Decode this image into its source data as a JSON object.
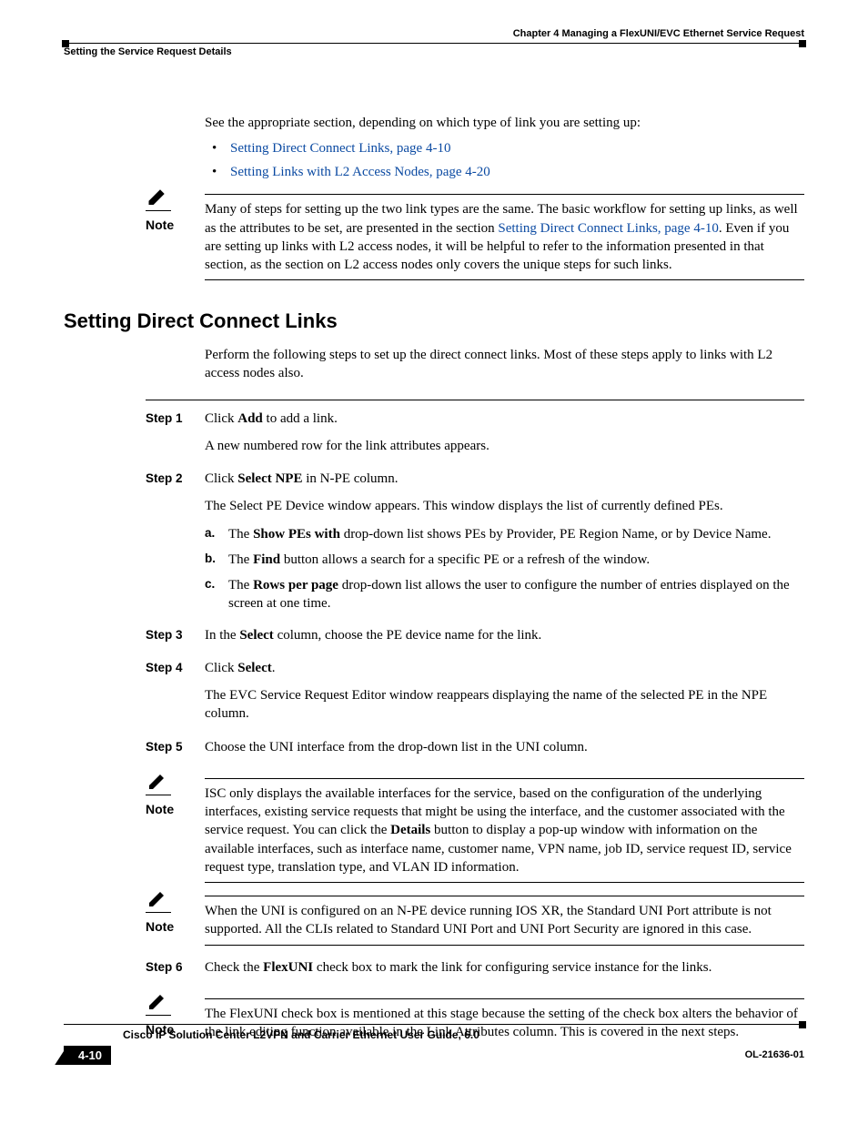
{
  "header": {
    "chapter": "Chapter 4      Managing a FlexUNI/EVC Ethernet Service Request",
    "section": "Setting the Service Request Details"
  },
  "intro": {
    "lead": "See the appropriate section, depending on which type of link you are setting up:",
    "bullets": [
      "Setting Direct Connect Links, page 4-10",
      "Setting Links with L2 Access Nodes, page 4-20"
    ]
  },
  "note1": {
    "label": "Note",
    "text_a": "Many of steps for setting up the two link types are the same. The basic workflow for setting up links, as well as the attributes to be set, are presented in the section ",
    "link": "Setting Direct Connect Links, page 4-10",
    "text_b": ". Even if you are setting up links with L2 access nodes, it will be helpful to refer to the information presented in that section, as the section on L2 access nodes only covers the unique steps for such links."
  },
  "section_title": "Setting Direct Connect Links",
  "section_intro": "Perform the following steps to set up the direct connect links. Most of these steps apply to links with L2 access nodes also.",
  "steps": {
    "s1": {
      "label": "Step 1",
      "p1a": "Click ",
      "p1b": "Add",
      "p1c": " to add a link.",
      "p2": "A new numbered row for the link attributes appears."
    },
    "s2": {
      "label": "Step 2",
      "p1a": "Click ",
      "p1b": "Select NPE",
      "p1c": " in N-PE column.",
      "p2": "The Select PE Device window appears. This window displays the list of currently defined PEs.",
      "a": {
        "letter": "a.",
        "pre": "The ",
        "bold": "Show PEs with",
        "post": " drop-down list shows PEs by Provider, PE Region Name, or by Device Name."
      },
      "b": {
        "letter": "b.",
        "pre": "The ",
        "bold": "Find",
        "post": " button allows a search for a specific PE or a refresh of the window."
      },
      "c": {
        "letter": "c.",
        "pre": "The ",
        "bold": "Rows per page",
        "post": " drop-down list allows the user to configure the number of entries displayed on the screen at one time."
      }
    },
    "s3": {
      "label": "Step 3",
      "pre": "In the ",
      "bold": "Select",
      "post": " column, choose the PE device name for the link."
    },
    "s4": {
      "label": "Step 4",
      "pre": "Click ",
      "bold": "Select",
      "post": ".",
      "p2": "The EVC Service Request Editor window reappears displaying the name of the selected PE in the NPE column."
    },
    "s5": {
      "label": "Step 5",
      "text": "Choose the UNI interface from the drop-down list in the UNI column."
    },
    "s6": {
      "label": "Step 6",
      "pre": "Check the ",
      "bold": "FlexUNI",
      "post": " check box to mark the link for configuring service instance for the links."
    }
  },
  "note2": {
    "label": "Note",
    "t1": "ISC only displays the available interfaces for the service, based on the configuration of the underlying interfaces, existing service requests that might be using the interface, and the customer associated with the service request. You can click the ",
    "bold": "Details",
    "t2": " button to display a pop-up window with information on the available interfaces, such as interface name, customer name, VPN name, job ID, service request ID, service request type, translation type, and VLAN ID information."
  },
  "note3": {
    "label": "Note",
    "text": "When the UNI is configured on an N-PE device running IOS XR, the Standard UNI Port attribute is not supported. All the CLIs related to Standard UNI Port and UNI Port Security are ignored in this case."
  },
  "note4": {
    "label": "Note",
    "text": "The FlexUNI check box is mentioned at this stage because the setting of the check box alters the behavior of the link editing function available in the Link Attributes column. This is covered in the next steps."
  },
  "footer": {
    "title": "Cisco IP Solution Center L2VPN and Carrier Ethernet User Guide, 6.0",
    "page": "4-10",
    "docid": "OL-21636-01"
  }
}
